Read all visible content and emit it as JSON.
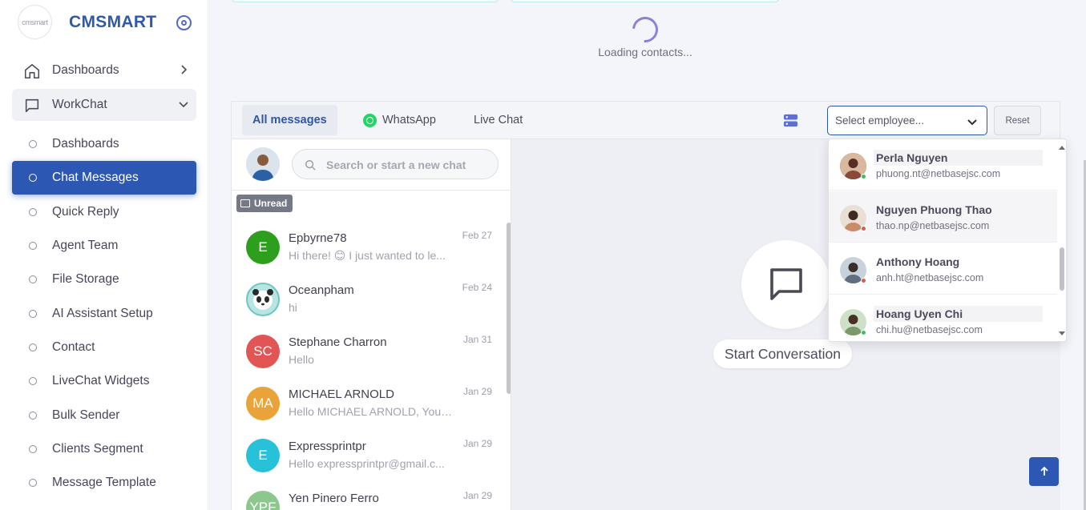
{
  "brand": {
    "name": "CMSMART",
    "logo_text": "cmsmart"
  },
  "sidebar": {
    "dashboards_label": "Dashboards",
    "workchat_label": "WorkChat",
    "sub_items": [
      {
        "label": "Dashboards"
      },
      {
        "label": "Chat Messages"
      },
      {
        "label": "Quick Reply"
      },
      {
        "label": "Agent Team"
      },
      {
        "label": "File Storage"
      },
      {
        "label": "AI Assistant Setup"
      },
      {
        "label": "Contact"
      },
      {
        "label": "LiveChat Widgets"
      },
      {
        "label": "Bulk Sender"
      },
      {
        "label": "Clients Segment"
      },
      {
        "label": "Message Template"
      }
    ],
    "active_item": "Chat Messages"
  },
  "loading": {
    "text": "Loading contacts..."
  },
  "tabs": [
    {
      "label": "All messages",
      "active": true
    },
    {
      "label": "WhatsApp",
      "icon": "whatsapp-icon"
    },
    {
      "label": "Live Chat"
    }
  ],
  "employee_select": {
    "placeholder": "Select employee..."
  },
  "reset_label": "Reset",
  "search": {
    "placeholder": "Search or start a new chat"
  },
  "unread_label": "Unread",
  "contacts": [
    {
      "initials": "E",
      "name": "Epbyrne78",
      "message": "Hi there! 😊 I just wanted to le...",
      "date": "Feb 27",
      "color": "#2e9e1f"
    },
    {
      "initials": "",
      "name": "Oceanpham",
      "message": "hi",
      "date": "Feb 24",
      "color": "#6fc7c3"
    },
    {
      "initials": "SC",
      "name": "Stephane Charron",
      "message": "Hello",
      "date": "Jan 31",
      "color": "#e25555"
    },
    {
      "initials": "MA",
      "name": "MICHAEL ARNOLD",
      "message": "Hello MICHAEL ARNOLD, You ...",
      "date": "Jan 29",
      "color": "#e9a33a"
    },
    {
      "initials": "E",
      "name": "Expressprintpr",
      "message": "Hello expressprintpr@gmail.c...",
      "date": "Jan 29",
      "color": "#27c1d9"
    },
    {
      "initials": "YPF",
      "name": "Yen Pinero Ferro",
      "message": "",
      "date": "Jan 29",
      "color": "#8cc88c"
    }
  ],
  "conversation": {
    "start_label": "Start Conversation"
  },
  "employees": [
    {
      "name": "Perla Nguyen",
      "email": "phuong.nt@netbasejsc.com",
      "status_color": "#3cc15a",
      "avatar_color": "#8a4a3a"
    },
    {
      "name": "Nguyen Phuong Thao",
      "email": "thao.np@netbasejsc.com",
      "status_color": "#e2574c",
      "avatar_color": "#c98b6a"
    },
    {
      "name": "Anthony Hoang",
      "email": "anh.ht@netbasejsc.com",
      "status_color": "#e2574c",
      "avatar_color": "#5f6f7f"
    },
    {
      "name": "Hoang Uyen Chi",
      "email": "chi.hu@netbasejsc.com",
      "status_color": "#3cc15a",
      "avatar_color": "#7a9a6a"
    }
  ],
  "colors": {
    "primary": "#2c57b3",
    "brand_text": "#2f5aa8",
    "spinner": "#8a82d8"
  }
}
